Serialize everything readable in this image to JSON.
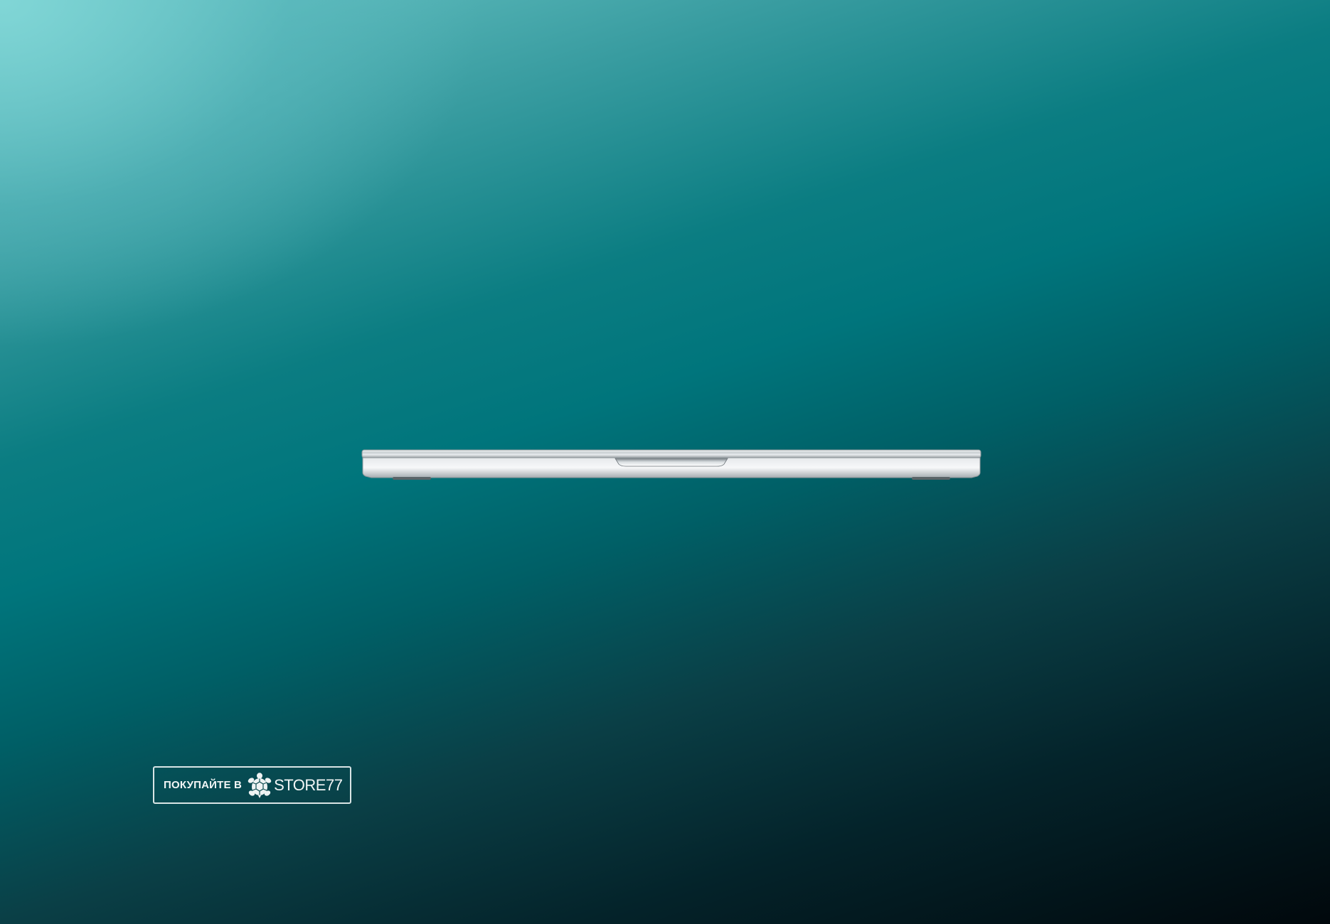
{
  "product": {
    "image": "closed-laptop-front-view",
    "color": "silver"
  },
  "badge": {
    "prefix": "ПОКУПАЙТЕ В",
    "brand": "STORE77",
    "logo_icon": "turtle-logo-icon",
    "border_color": "#ebf2f2"
  },
  "colors": {
    "background_light": "#6fc9c9",
    "background_mid": "#00757c",
    "background_dark": "#01080c"
  }
}
